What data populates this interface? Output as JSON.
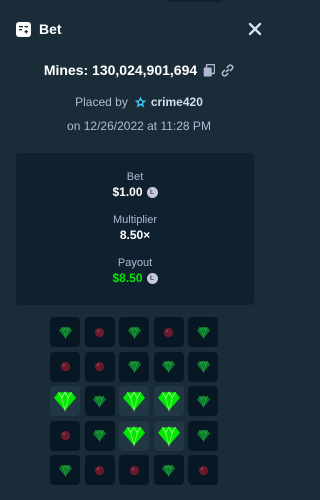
{
  "header": {
    "title": "Bet",
    "bet_icon": "receipt-icon",
    "close_icon": "close-icon"
  },
  "bet_info": {
    "mines_label": "Mines: 130,024,901,694",
    "copy_icon": "copy-icon",
    "link_icon": "link-icon",
    "placed_by_prefix": "Placed by",
    "user_badge_icon": "star-badge-icon",
    "username": "crime420",
    "date": "on 12/26/2022 at 11:28 PM"
  },
  "stats": {
    "bet_label": "Bet",
    "bet_value": "$1.00",
    "multiplier_label": "Multiplier",
    "multiplier_value": "8.50×",
    "payout_label": "Payout",
    "payout_value": "$8.50",
    "currency_icon": "litecoin-icon"
  },
  "grid": {
    "rows": [
      [
        "gem-dim",
        "mine-dim",
        "gem-dim",
        "mine-dim",
        "gem-dim"
      ],
      [
        "mine-dim",
        "mine-dim",
        "gem-dim",
        "gem-dim",
        "gem-dim"
      ],
      [
        "gem",
        "gem-dim",
        "gem",
        "gem",
        "gem-dim"
      ],
      [
        "mine-dim",
        "gem-dim",
        "gem",
        "gem",
        "gem-dim"
      ],
      [
        "gem-dim",
        "mine-dim",
        "mine-dim",
        "gem-dim",
        "mine-dim"
      ]
    ]
  },
  "colors": {
    "background": "#1a2c38",
    "card": "#0f212e",
    "tile": "#213743",
    "gem_bright": "#00e701",
    "gem_dim": "#0a7a2a",
    "mine_dim": "#6b1a2e",
    "payout_green": "#00e701"
  }
}
